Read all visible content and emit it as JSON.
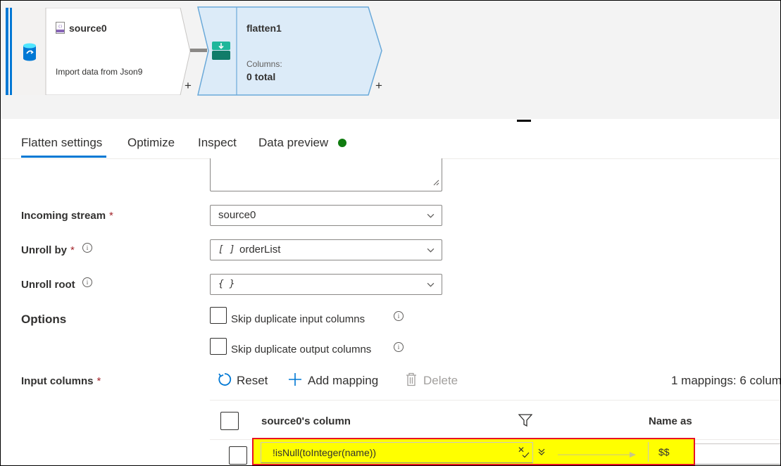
{
  "nodes": {
    "source": {
      "title": "source0",
      "subtitle": "Import data from Json9",
      "plus": "+"
    },
    "flatten": {
      "title": "flatten1",
      "columns_label": "Columns:",
      "columns_value": "0 total",
      "plus": "+"
    }
  },
  "tabs": [
    {
      "label": "Flatten settings"
    },
    {
      "label": "Optimize"
    },
    {
      "label": "Inspect"
    },
    {
      "label": "Data preview"
    }
  ],
  "colors": {
    "accent": "#0078d4",
    "status_ok": "#107c10",
    "highlight": "#ffff00",
    "highlight_border": "#e81123",
    "node_selected": "#dcebf8"
  },
  "form": {
    "incoming_stream": {
      "label": "Incoming stream",
      "required": "*",
      "value": "source0"
    },
    "unroll_by": {
      "label": "Unroll by",
      "required": "*",
      "value_icon": "[ ]",
      "value": "orderList"
    },
    "unroll_root": {
      "label": "Unroll root",
      "value": "{ }"
    },
    "options": {
      "label": "Options",
      "skip_input": "Skip duplicate input columns",
      "skip_output": "Skip duplicate output columns"
    },
    "input_columns": {
      "label": "Input columns",
      "required": "*"
    }
  },
  "toolbar": {
    "reset": "Reset",
    "add_mapping": "Add mapping",
    "delete": "Delete",
    "summary": "1 mappings: 6 colum"
  },
  "mapping_table": {
    "headers": {
      "source_column": "source0's column",
      "name_as": "Name as"
    },
    "rows": [
      {
        "expression": "!isNull(toInteger(name))",
        "name_as": "$$"
      }
    ]
  }
}
